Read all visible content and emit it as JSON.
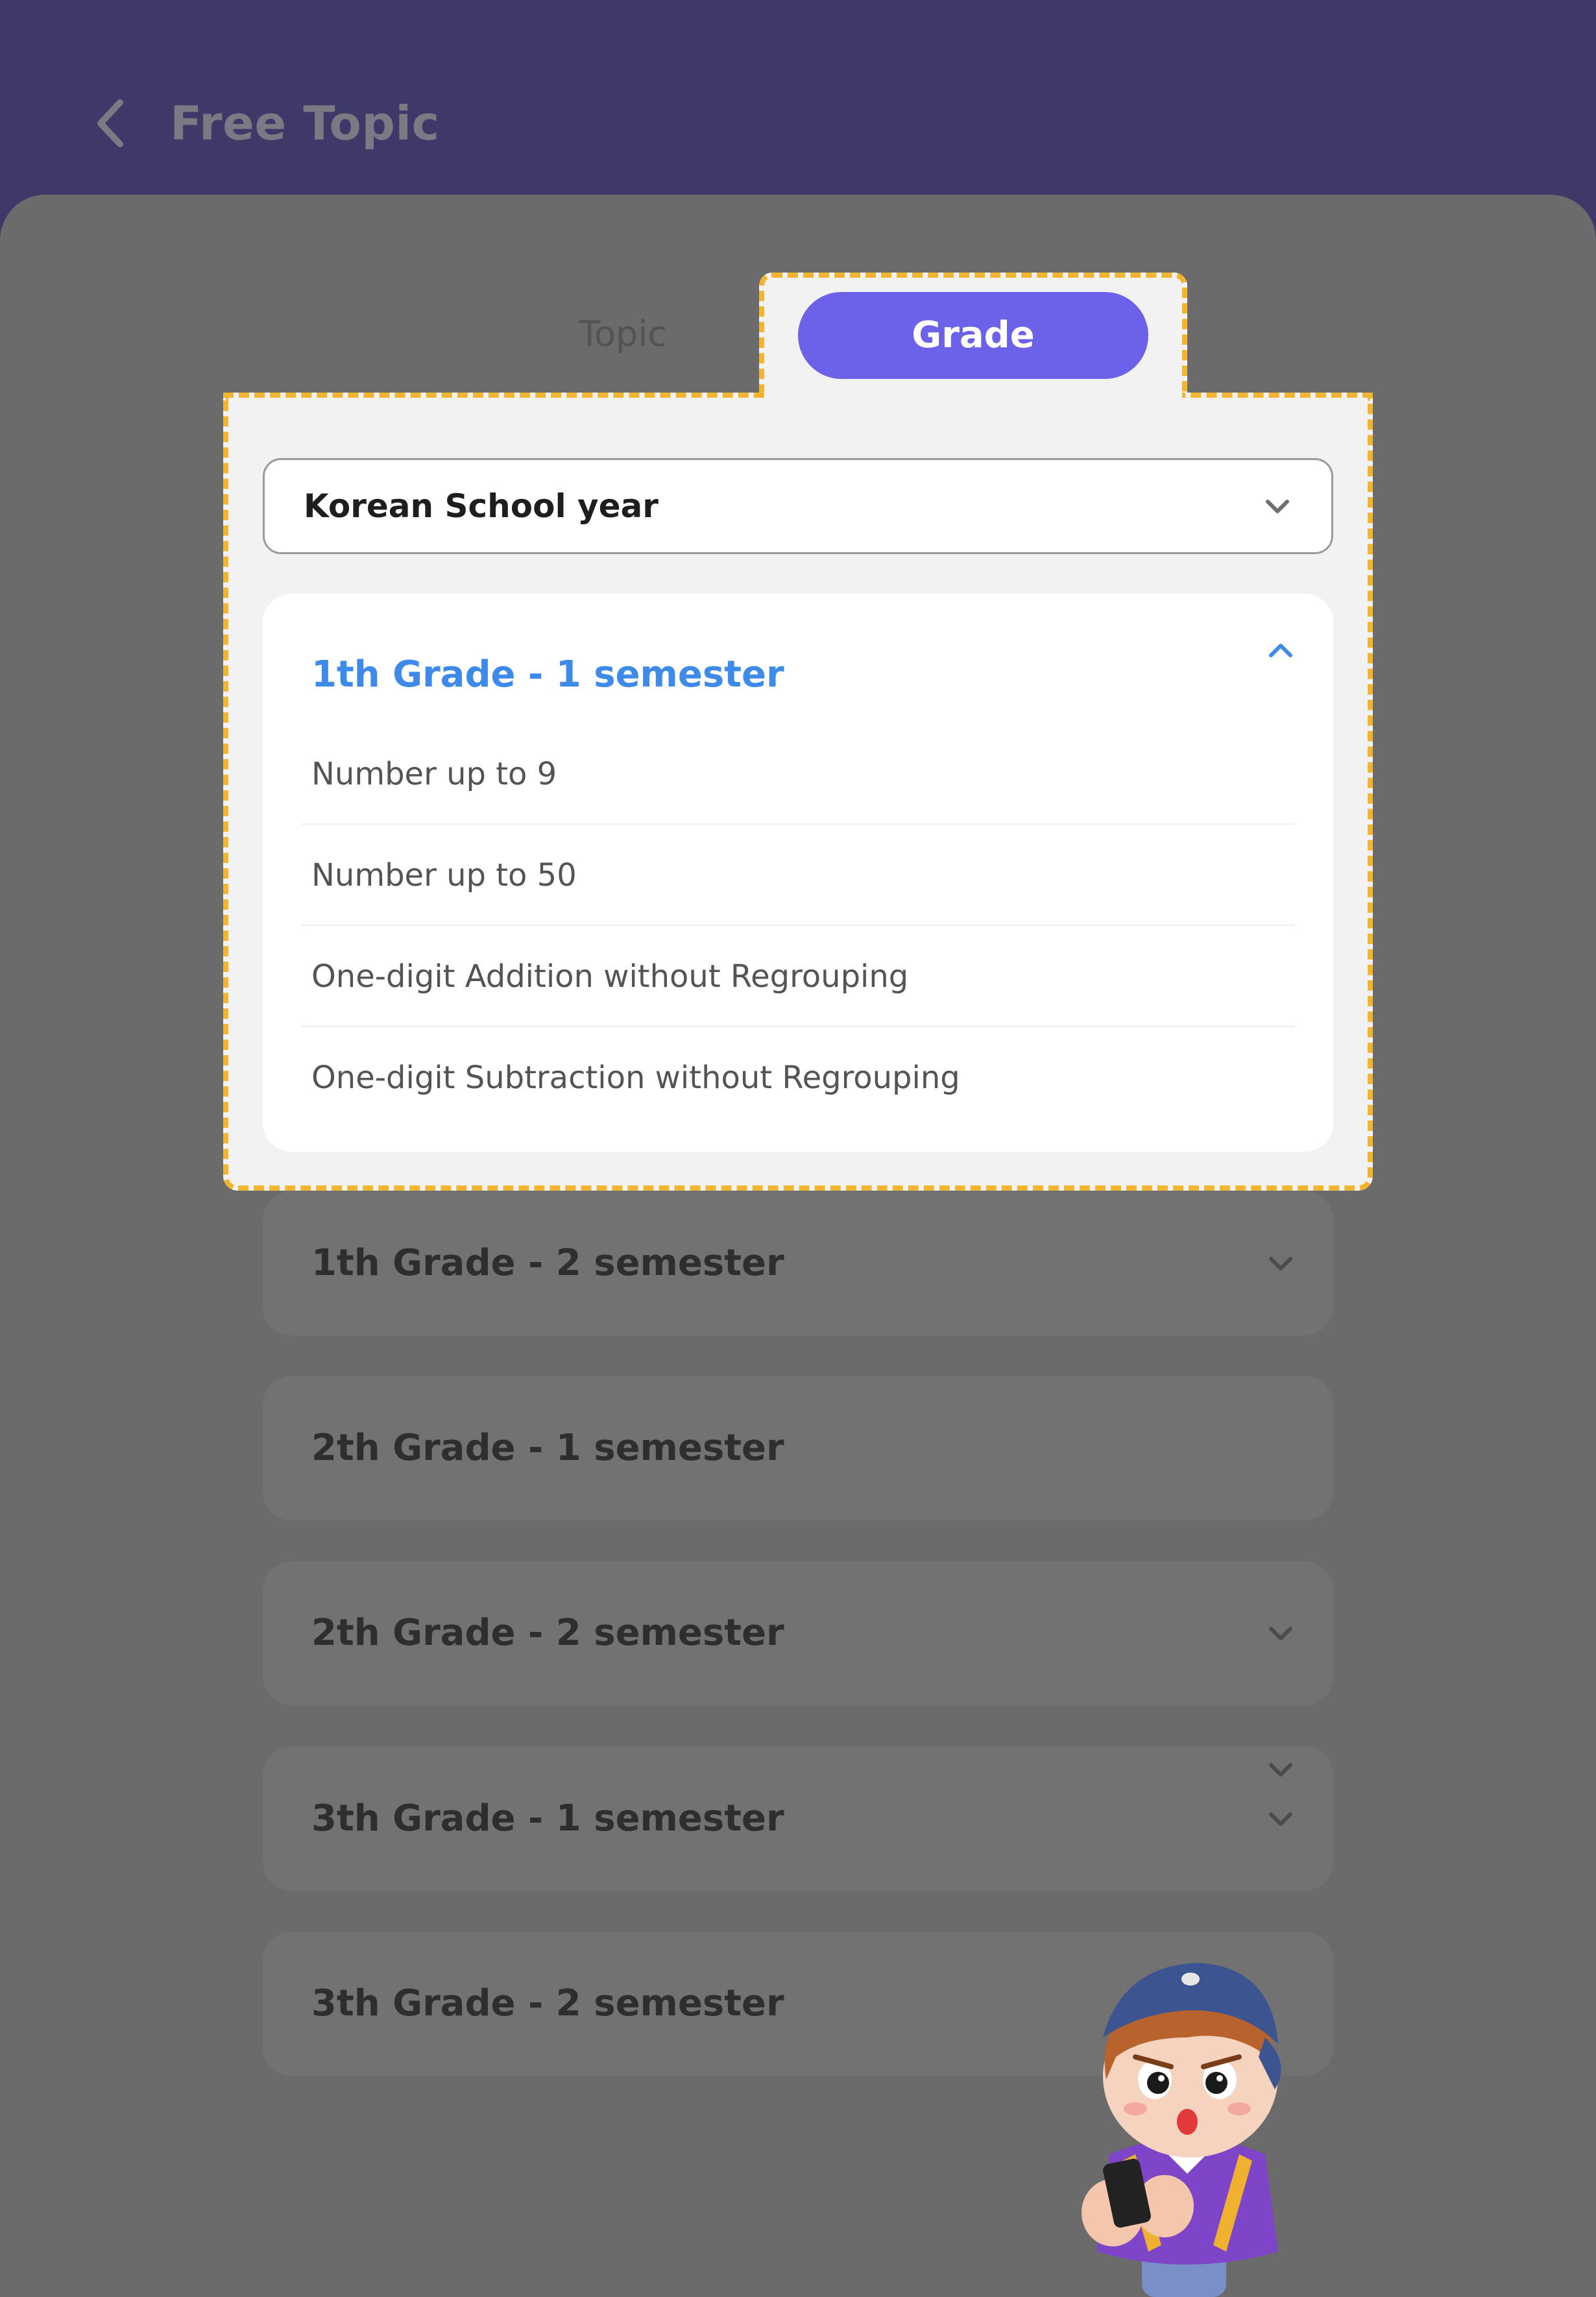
{
  "header": {
    "title": "Free Topic",
    "back_icon": "chevron-left-icon"
  },
  "tabs": {
    "topic_label": "Topic",
    "grade_label": "Grade",
    "active": "Grade"
  },
  "school_year_select": {
    "value": "Korean School year",
    "icon": "chevron-down-icon"
  },
  "grades": [
    {
      "label": "1th Grade - 1 semester",
      "expanded": true,
      "icon": "chevron-up-icon",
      "lessons": [
        "Number up to 9",
        "Number up to 50",
        "One-digit Addition without Regrouping",
        "One-digit Subtraction without Regrouping"
      ]
    },
    {
      "label": "1th Grade - 2 semester",
      "expanded": false,
      "icon": "chevron-down-icon"
    },
    {
      "label": "2th Grade - 1 semester",
      "expanded": false
    },
    {
      "label": "2th Grade - 2 semester",
      "expanded": false,
      "icon": "chevron-down-icon"
    },
    {
      "label": "3th Grade - 1 semester",
      "expanded": false,
      "icon": "chevron-down-icon"
    },
    {
      "label": "3th Grade - 2 semester",
      "expanded": false
    }
  ],
  "colors": {
    "header_bg": "#3f3969",
    "overlay_bg": "#6b6b6b",
    "accent_purple": "#6c62ea",
    "active_grade_blue": "#3d8ae8",
    "highlight_dash": "#f2b531"
  },
  "mascot": {
    "icon": "boy-with-phone-character"
  }
}
